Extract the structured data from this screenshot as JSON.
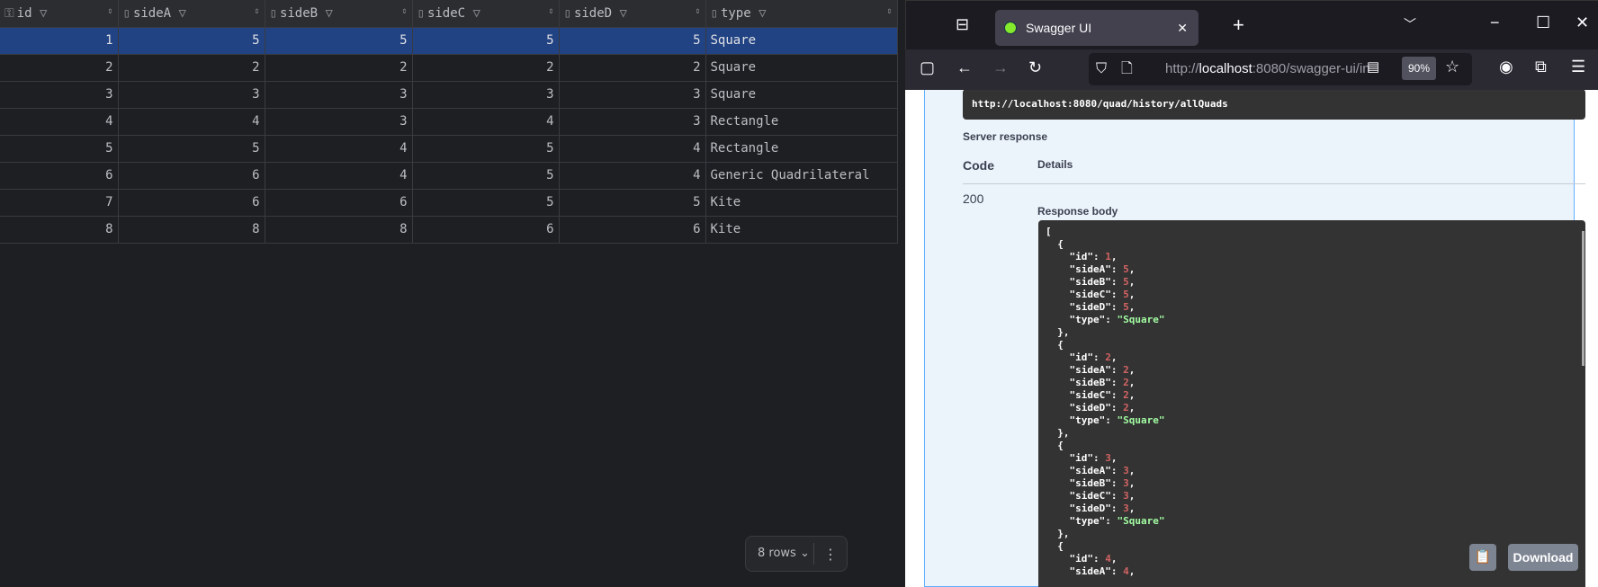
{
  "grid": {
    "columns": [
      {
        "label": "id",
        "icon": "key-column-icon"
      },
      {
        "label": "sideA",
        "icon": "column-icon"
      },
      {
        "label": "sideB",
        "icon": "column-icon"
      },
      {
        "label": "sideC",
        "icon": "column-icon"
      },
      {
        "label": "sideD",
        "icon": "column-icon"
      },
      {
        "label": "type",
        "icon": "column-icon"
      }
    ],
    "rows": [
      [
        1,
        5,
        5,
        5,
        5,
        "Square"
      ],
      [
        2,
        2,
        2,
        2,
        2,
        "Square"
      ],
      [
        3,
        3,
        3,
        3,
        3,
        "Square"
      ],
      [
        4,
        4,
        3,
        4,
        3,
        "Rectangle"
      ],
      [
        5,
        5,
        4,
        5,
        4,
        "Rectangle"
      ],
      [
        6,
        6,
        4,
        5,
        4,
        "Generic Quadrilateral"
      ],
      [
        7,
        6,
        6,
        5,
        5,
        "Kite"
      ],
      [
        8,
        8,
        8,
        6,
        6,
        "Kite"
      ]
    ],
    "selected_row": 1,
    "row_count_label": "8 rows"
  },
  "browser": {
    "tab_title": "Swagger UI",
    "url_prefix": "http://",
    "url_host": "localhost",
    "url_rest": ":8080/swagger-ui/in",
    "zoom": "90%"
  },
  "swagger": {
    "request_url": "http://localhost:8080/quad/history/allQuads",
    "server_response": "Server response",
    "code_header": "Code",
    "details_header": "Details",
    "code": "200",
    "response_body_label": "Response body",
    "download_label": "Download"
  },
  "colors": {
    "selection": "#214283",
    "json_number": "#d36363",
    "json_string": "#a2fca2",
    "swagger_border": "#61affe"
  }
}
